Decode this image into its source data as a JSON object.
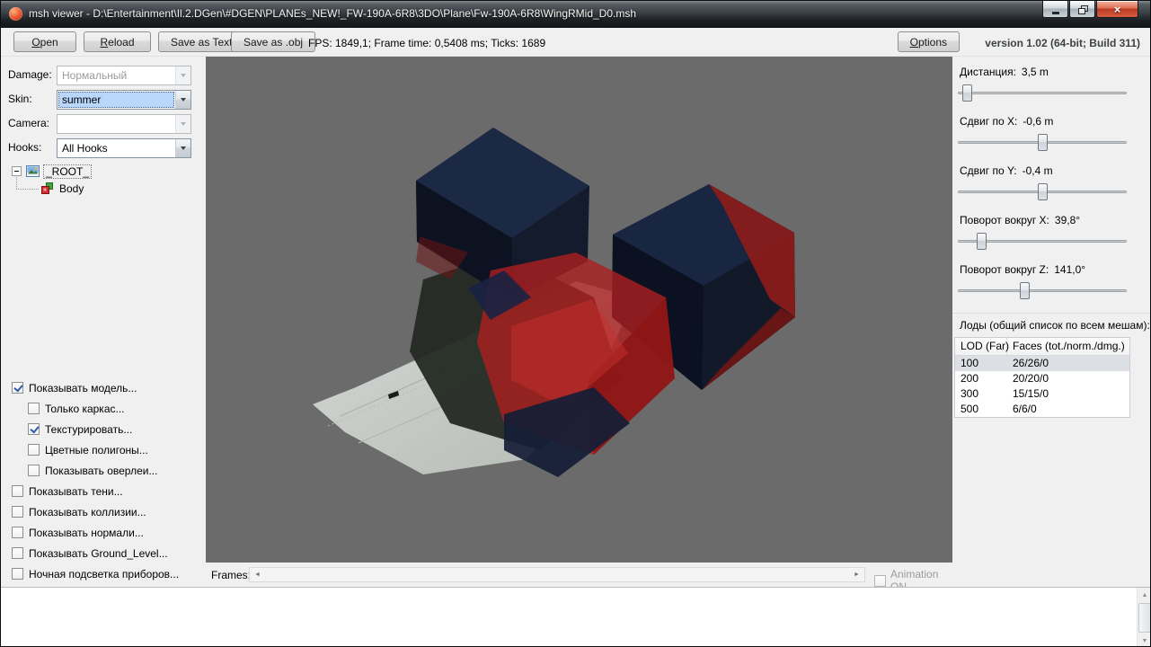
{
  "titlebar": {
    "title": "msh viewer - D:\\Entertainment\\Il.2.DGen\\#DGEN\\PLANEs_NEW!_FW-190A-6R8\\3DO\\Plane\\Fw-190A-6R8\\WingRMid_D0.msh"
  },
  "icons": {
    "close_glyph": "×",
    "scroll_left": "◄",
    "scroll_right": "►",
    "scroll_up": "▲",
    "scroll_down": "▼"
  },
  "colors": {
    "viewport_bg": "#6b6b6b",
    "combo_focus_highlight": "#b8d7fb",
    "row_selection": "#dcdfe3"
  },
  "toolbar": {
    "open_label": "Open",
    "reload_label": "Reload",
    "save_text_label": "Save as Text",
    "save_obj_label": "Save as .obj",
    "stats": "FPS: 1849,1; Frame time: 0,5408 ms; Ticks: 1689",
    "options_label": "Options",
    "version": "version 1.02 (64-bit; Build 311)"
  },
  "left_panel": {
    "damage_label": "Damage:",
    "damage_value": "Нормальный",
    "skin_label": "Skin:",
    "skin_value": "summer",
    "camera_label": "Camera:",
    "camera_value": "",
    "hooks_label": "Hooks:",
    "hooks_value": "All Hooks",
    "tree": {
      "root_label": "_ROOT_",
      "body_label": "Body"
    },
    "checkboxes": [
      {
        "label": "Показывать модель...",
        "checked": true,
        "indent": false
      },
      {
        "label": "Только каркас...",
        "checked": false,
        "indent": true
      },
      {
        "label": "Текстурировать...",
        "checked": true,
        "indent": true
      },
      {
        "label": "Цветные полигоны...",
        "checked": false,
        "indent": true
      },
      {
        "label": "Показывать оверлеи...",
        "checked": false,
        "indent": true
      },
      {
        "label": "Показывать тени...",
        "checked": false,
        "indent": false
      },
      {
        "label": "Показывать коллизии...",
        "checked": false,
        "indent": false
      },
      {
        "label": "Показывать нормали...",
        "checked": false,
        "indent": false
      },
      {
        "label": "Показывать Ground_Level...",
        "checked": false,
        "indent": false
      },
      {
        "label": "Ночная подсветка приборов...",
        "checked": false,
        "indent": false
      }
    ]
  },
  "viewport": {
    "frames_label": "Frames:",
    "animation_label": "Animation ON"
  },
  "right_panel": {
    "sliders": [
      {
        "label": "Дистанция:",
        "value": "3,5 m",
        "pos": 3
      },
      {
        "label": "Сдвиг по X:",
        "value": "-0,6 m",
        "pos": 50
      },
      {
        "label": "Сдвиг по Y:",
        "value": "-0,4 m",
        "pos": 50
      },
      {
        "label": "Поворот вокруг X:",
        "value": "39,8°",
        "pos": 12
      },
      {
        "label": "Поворот вокруг Z:",
        "value": "141,0°",
        "pos": 39
      }
    ],
    "lods_title": "Лоды (общий список по всем мешам):",
    "table": {
      "col1_header": "LOD (Far)",
      "col2_header": "Faces (tot./norm./dmg.)",
      "rows": [
        {
          "lod": "100",
          "faces": "26/26/0"
        },
        {
          "lod": "200",
          "faces": "20/20/0"
        },
        {
          "lod": "300",
          "faces": "15/15/0"
        },
        {
          "lod": "500",
          "faces": "6/6/0"
        }
      ],
      "selected_row": 0
    }
  }
}
